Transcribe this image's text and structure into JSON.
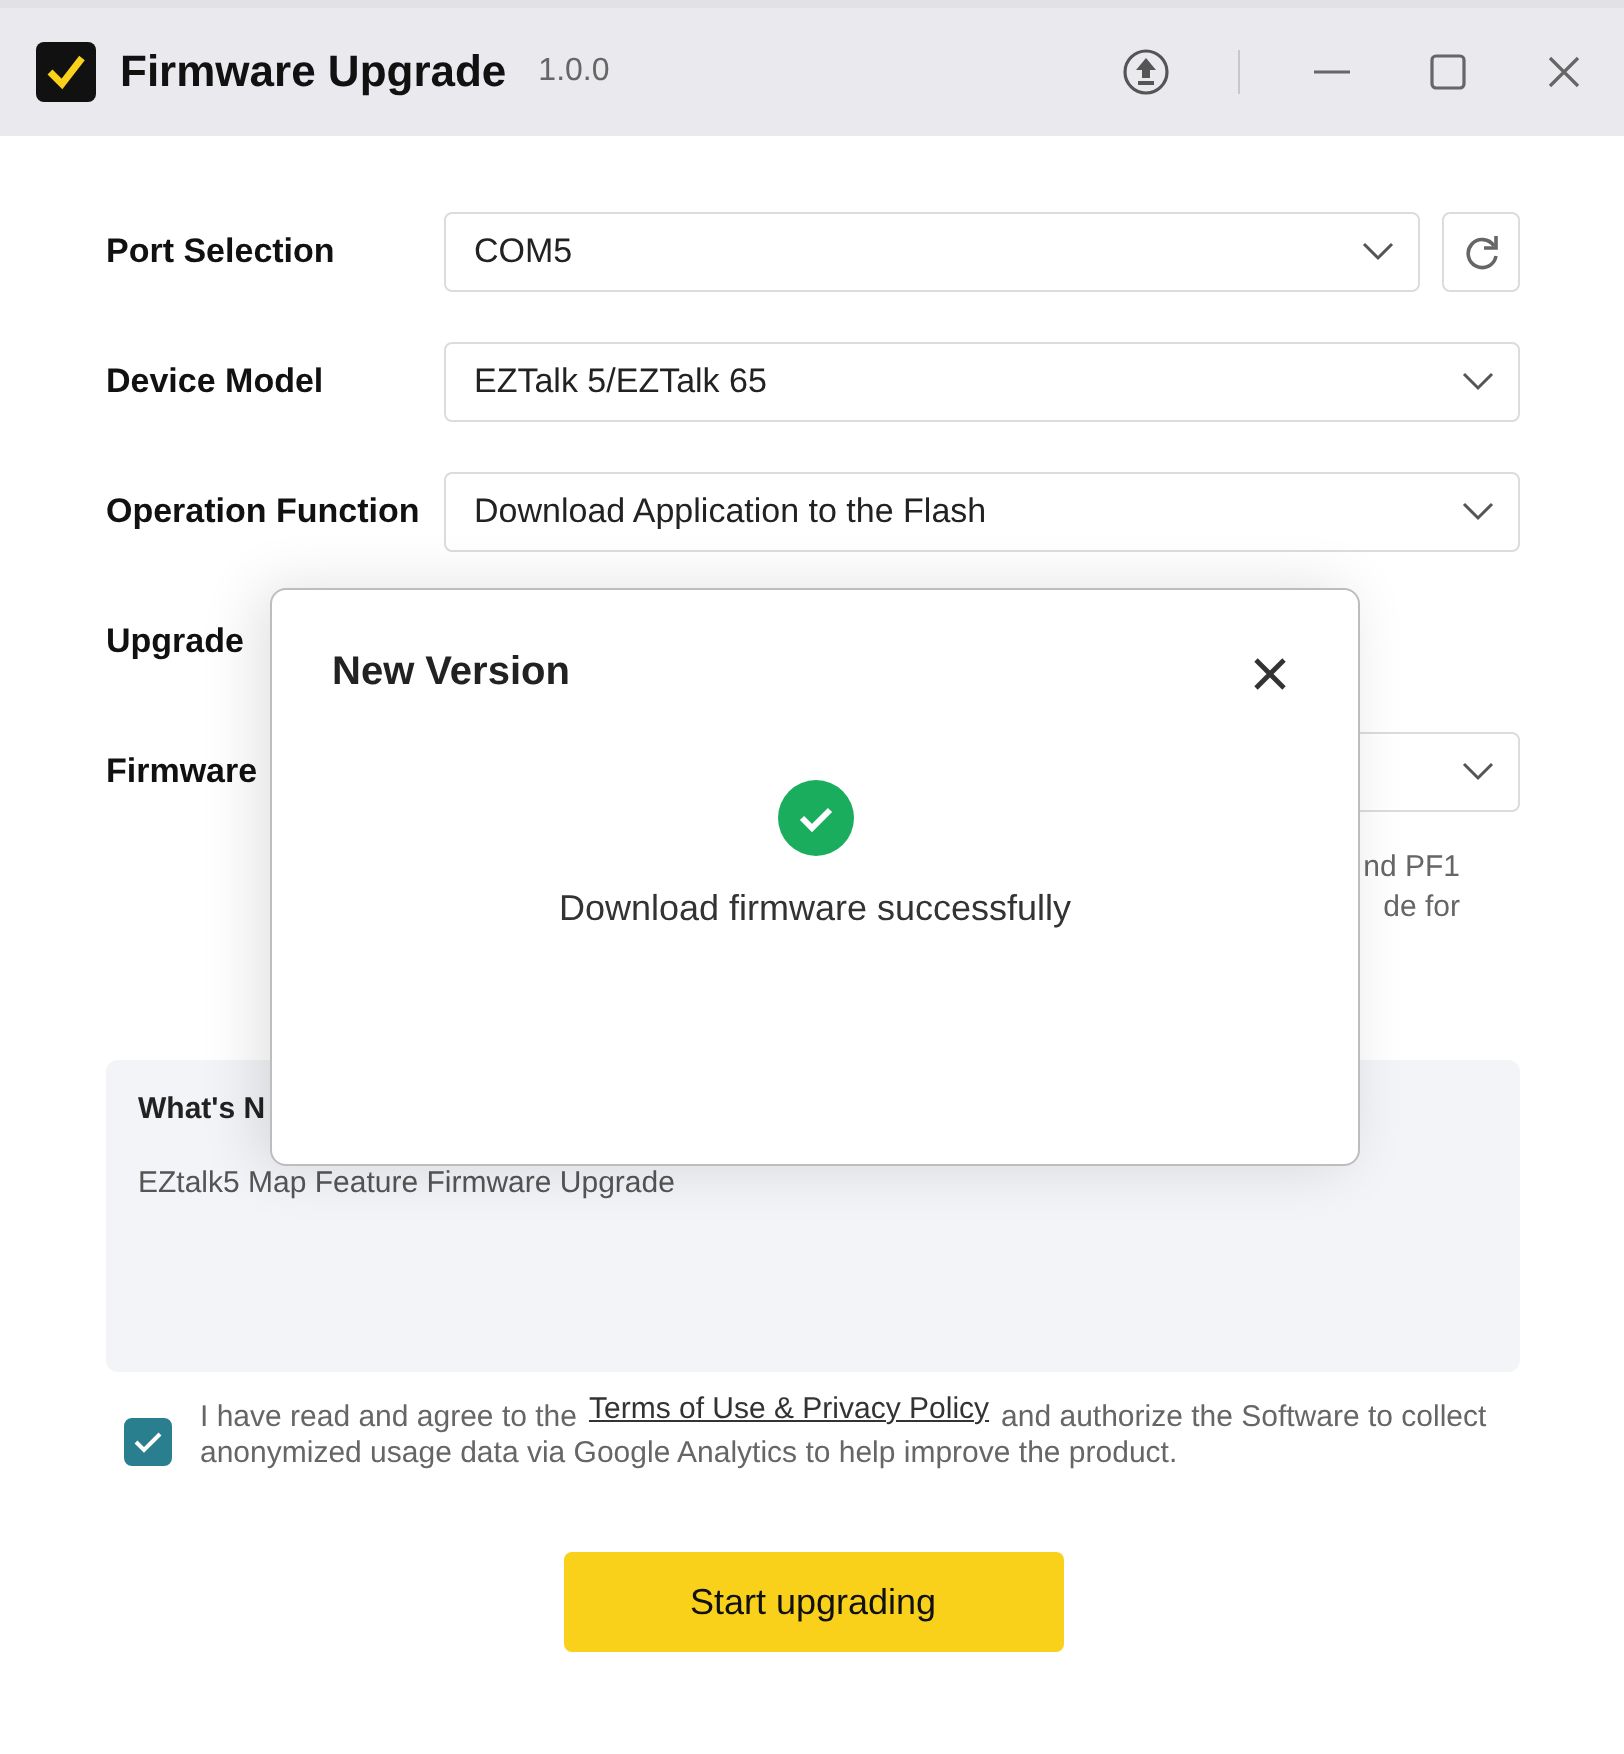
{
  "window": {
    "title": "Firmware Upgrade",
    "version": "1.0.0"
  },
  "form": [
    {
      "kind": "select",
      "label": "Port Selection",
      "value": "COM5",
      "refresh": true
    },
    {
      "kind": "select",
      "label": "Device Model",
      "value": "EZTalk 5/EZTalk 65",
      "refresh": false
    },
    {
      "kind": "select",
      "label": "Operation Function",
      "value": "Download Application to the Flash",
      "refresh": false
    },
    {
      "kind": "text",
      "label": "Upgrade"
    },
    {
      "kind": "select",
      "label": "Firmware",
      "refresh": false
    }
  ],
  "description": [
    "nd PF1",
    "de for"
  ],
  "whats_new": {
    "title": "What's N",
    "text": "EZtalk5 Map Feature Firmware Upgrade"
  },
  "agreement": {
    "checked": true,
    "before": "I have read and agree to the",
    "link": "Terms of Use & Privacy Policy",
    "after": "and authorize the Software to collect anonymized usage data via Google Analytics to help improve the product."
  },
  "start_button": "Start upgrading",
  "dialog": {
    "title": "New Version",
    "message": "Download firmware successfully"
  }
}
